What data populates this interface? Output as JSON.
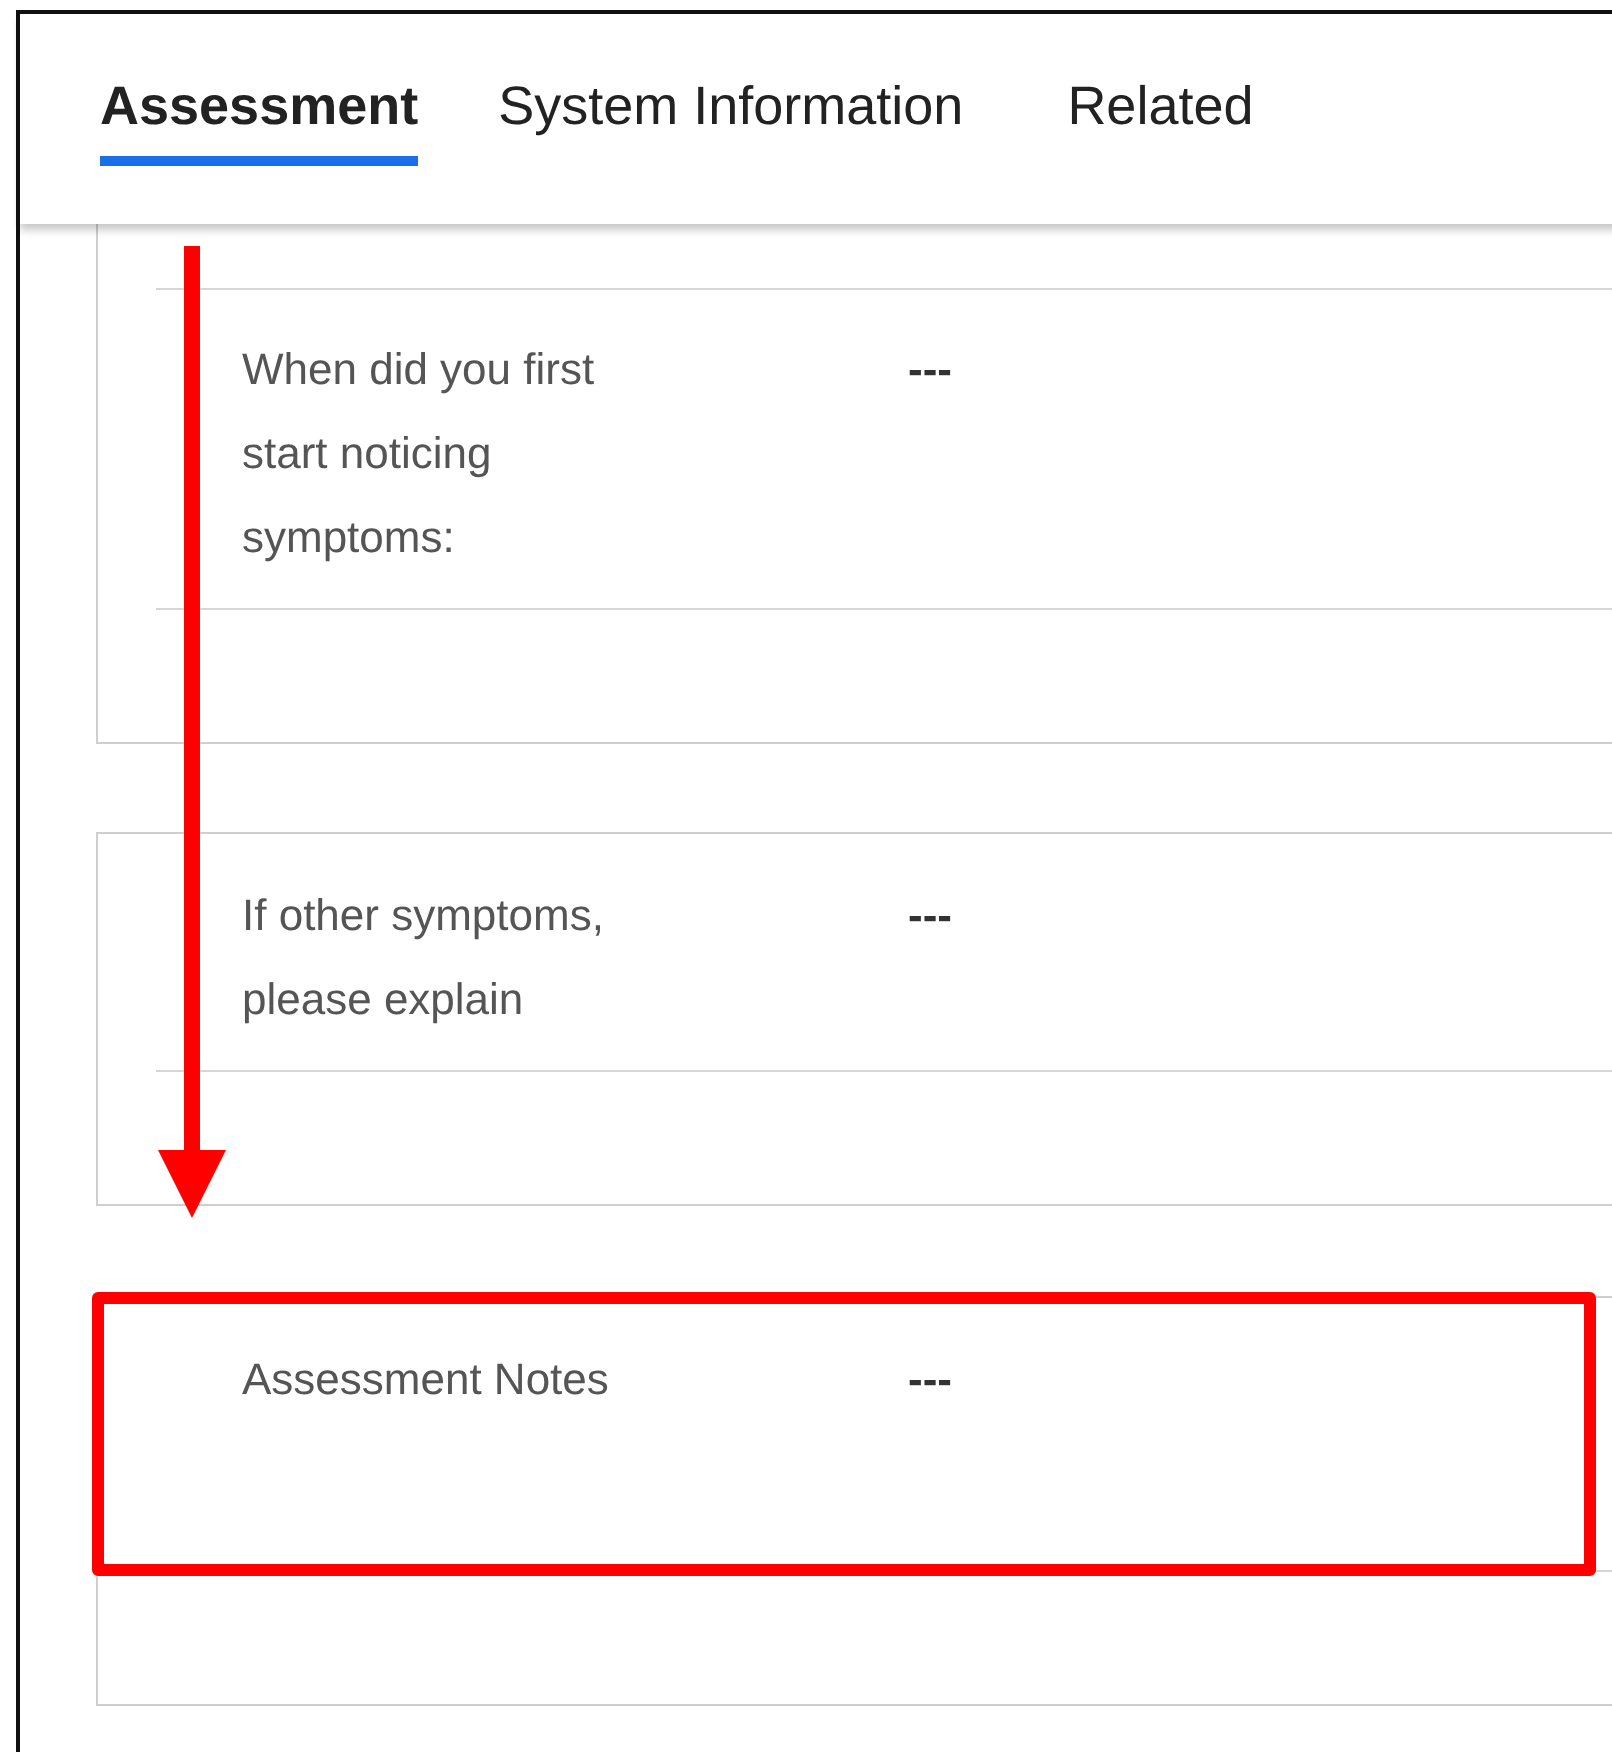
{
  "tabs": [
    {
      "label": "Assessment",
      "selected": true
    },
    {
      "label": "System Information",
      "selected": false
    },
    {
      "label": "Related",
      "selected": false
    }
  ],
  "sections": [
    {
      "label": "When did you first start noticing symptoms:",
      "value": "---",
      "kind": "text",
      "highlighted": false
    },
    {
      "label": "If other symptoms, please explain",
      "value": "---",
      "kind": "text",
      "highlighted": false
    },
    {
      "label": "Assessment Notes",
      "value": "---",
      "kind": "notes",
      "highlighted": true
    }
  ]
}
